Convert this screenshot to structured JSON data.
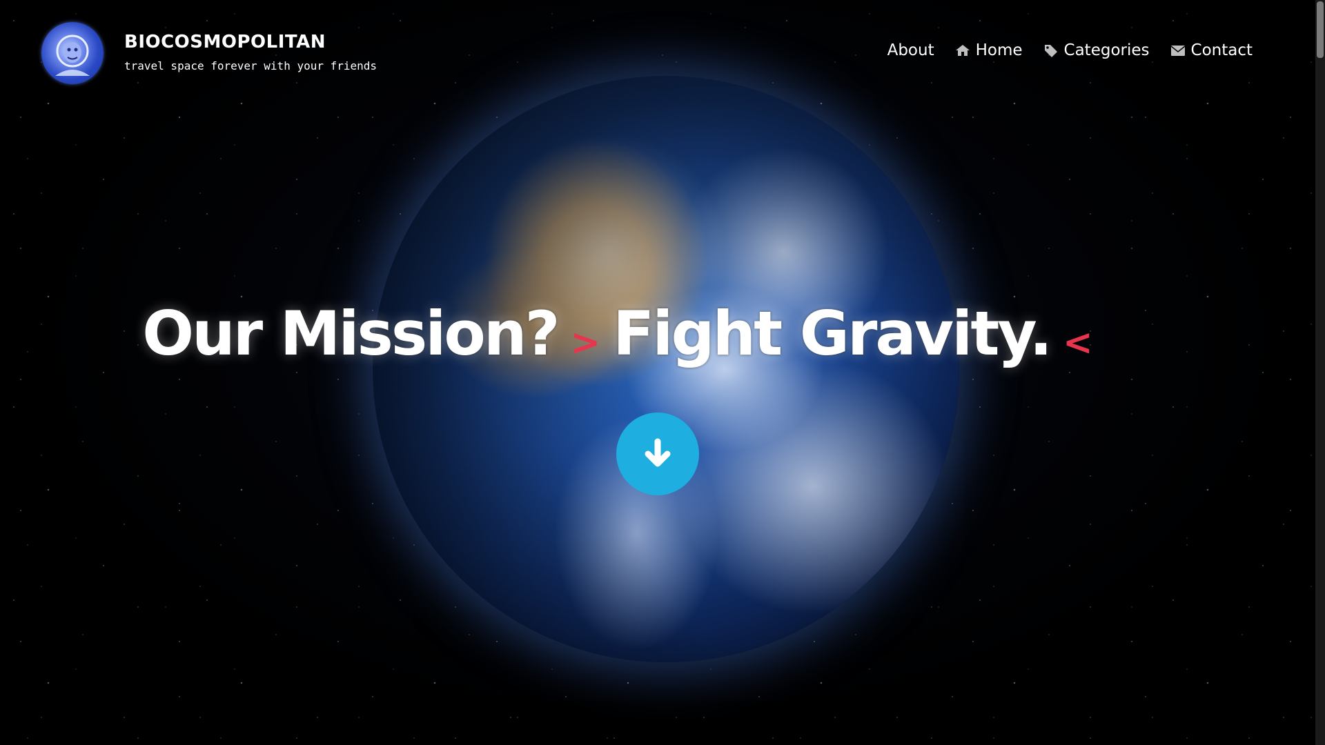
{
  "brand": {
    "title": "BIOCOSMOPOLITAN",
    "tagline": "travel space forever with your friends"
  },
  "nav": {
    "items": [
      {
        "label": "About",
        "icon": ""
      },
      {
        "label": "Home",
        "icon": "home-icon"
      },
      {
        "label": "Categories",
        "icon": "tag-icon"
      },
      {
        "label": "Contact",
        "icon": "envelope-icon"
      }
    ]
  },
  "hero": {
    "part1": "Our Mission?",
    "bracket_open": ">",
    "part2": "Fight Gravity.",
    "bracket_close": "<",
    "scroll_icon": "arrow-down-icon"
  },
  "colors": {
    "accent_red": "#e8344f",
    "button_blue": "#1faee0",
    "background": "#000000"
  }
}
